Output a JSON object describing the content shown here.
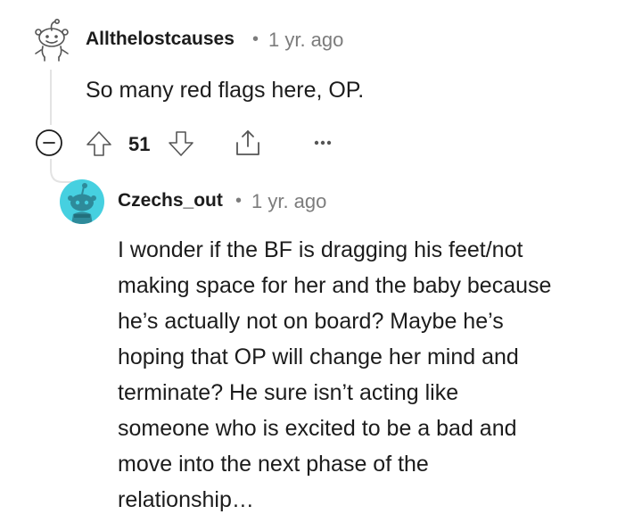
{
  "comments": [
    {
      "author": "Allthelostcauses",
      "separator": "•",
      "time": "1 yr. ago",
      "body": "So many red flags here, OP.",
      "vote_count": "51",
      "avatar_icon": "snoo-outline-avatar-icon"
    },
    {
      "author": "Czechs_out",
      "separator": "•",
      "time": "1 yr. ago",
      "body_lines": [
        "I wonder if the BF is dragging his feet/not",
        "making space for her and the baby because",
        "he’s actually not on board? Maybe he’s",
        "hoping that OP will change her mind and",
        "terminate? He sure isn’t acting like",
        "someone who is excited to be a bad and",
        "move into the next phase of the",
        "relationship…"
      ],
      "avatar_icon": "snoo-default-avatar-icon"
    }
  ],
  "actions": {
    "collapse_icon": "collapse-minus-icon",
    "upvote_icon": "upvote-arrow-icon",
    "downvote_icon": "downvote-arrow-icon",
    "share_icon": "share-icon",
    "more_icon": "more-options-icon"
  },
  "colors": {
    "text": "#1c1c1c",
    "meta": "#7c7c7c",
    "thread_line": "#e3e3e3",
    "avatar_bg": "#46d0e0",
    "avatar_body": "#2e8a9a"
  }
}
